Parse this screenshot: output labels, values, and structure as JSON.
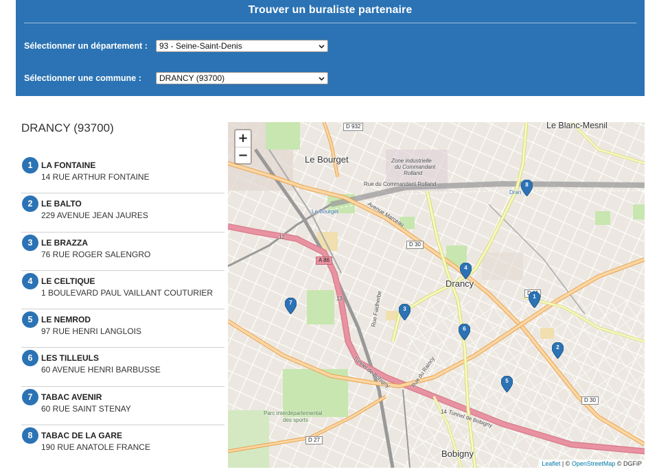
{
  "header": {
    "title": "Trouver un buraliste partenaire",
    "department_label": "Sélectionner un département :",
    "department_value": "93 - Seine-Saint-Denis",
    "commune_label": "Sélectionner une commune :",
    "commune_value": "DRANCY (93700)"
  },
  "city_title": "DRANCY (93700)",
  "shops": [
    {
      "num": "1",
      "name": "LA FONTAINE",
      "address": "14 RUE ARTHUR FONTAINE"
    },
    {
      "num": "2",
      "name": "LE BALTO",
      "address": "229 AVENUE JEAN JAURES"
    },
    {
      "num": "3",
      "name": "LE BRAZZA",
      "address": "76 RUE ROGER SALENGRO"
    },
    {
      "num": "4",
      "name": "LE CELTIQUE",
      "address": "1 BOULEVARD PAUL VAILLANT COUTURIER"
    },
    {
      "num": "5",
      "name": "LE NEMROD",
      "address": "97 RUE HENRI LANGLOIS"
    },
    {
      "num": "6",
      "name": "LES TILLEULS",
      "address": "60 AVENUE HENRI BARBUSSE"
    },
    {
      "num": "7",
      "name": "TABAC AVENIR",
      "address": "60 RUE SAINT STENAY"
    },
    {
      "num": "8",
      "name": "TABAC DE LA GARE",
      "address": "190 RUE ANATOLE FRANCE"
    }
  ],
  "map": {
    "zoom_in": "+",
    "zoom_out": "−",
    "places": {
      "le_bourget": "Le Bourget",
      "le_blanc_mesnil": "Le Blanc-Mesnil",
      "drancy": "Drancy",
      "bobigny": "Bobigny",
      "zone_line1": "Zone industrielle",
      "zone_line2": "du Commandant",
      "zone_line3": "Rolland",
      "station_le_bourget": "Le Bourget",
      "station_drancy": "Dran",
      "parc_line1": "Parc interdépartemental",
      "parc_line2": "des sports"
    },
    "roads": {
      "d932": "D 932",
      "d30a": "D 30",
      "d30b": "D 30",
      "d27": "D 27",
      "a86": "A 86",
      "d115": "D 11",
      "n12": "12",
      "n13": "13",
      "n14": "14",
      "av_marceau": "Avenue Marceau",
      "rue_commandant": "Rue du Commandant Rolland",
      "tunnel_bobigny": "Tunnel de Bobigny",
      "tunnel_bobigny2": "Tunnel de Bobigny",
      "rue_raincy": "Rue du Raincy",
      "rue_faidherbe": "Rue Faidherbe"
    },
    "markers": [
      {
        "num": "1"
      },
      {
        "num": "2"
      },
      {
        "num": "3"
      },
      {
        "num": "4"
      },
      {
        "num": "5"
      },
      {
        "num": "6"
      },
      {
        "num": "7"
      },
      {
        "num": "8"
      }
    ],
    "attribution": {
      "leaflet": "Leaflet",
      "sep1": " | © ",
      "osm": "OpenStreetMap",
      "sep2": " © DGFiP"
    },
    "colors": {
      "marker": "#2b73b4",
      "motorway": "#e892a2",
      "primary": "#fcd6a4",
      "secondary": "#f7fabf",
      "park": "#c8e6b0"
    }
  }
}
